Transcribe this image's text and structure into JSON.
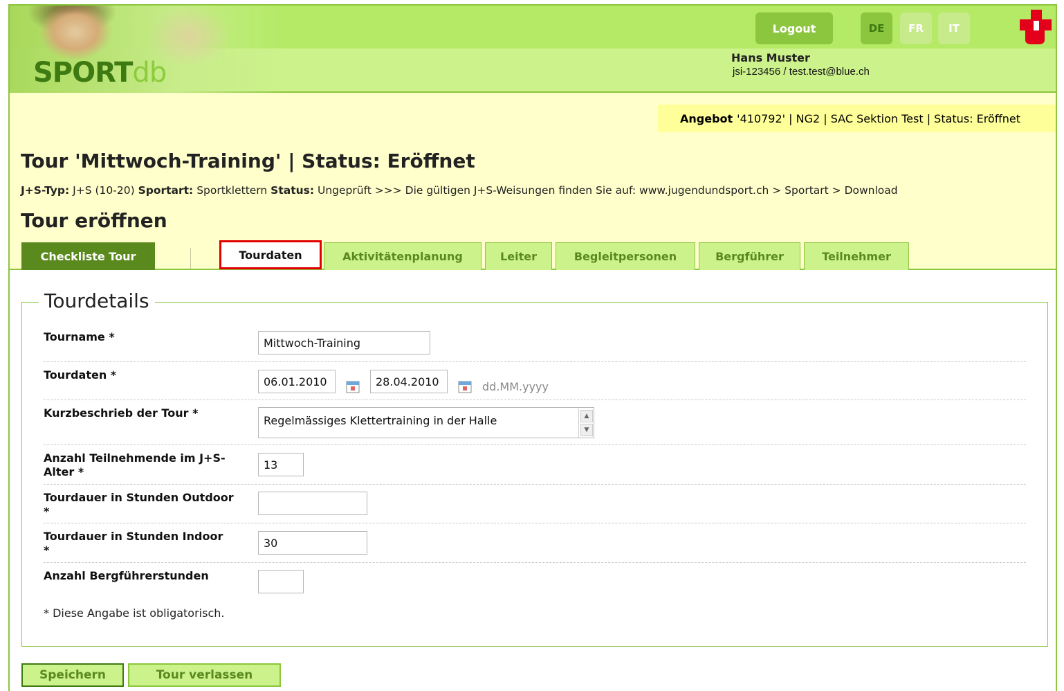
{
  "header": {
    "logo_sport": "SPORT",
    "logo_db": "db",
    "logout_label": "Logout",
    "languages": [
      "DE",
      "FR",
      "IT"
    ],
    "active_language": "DE",
    "user_name": "Hans Muster",
    "user_meta": "jsi-123456 / test.test@blue.ch"
  },
  "offer": {
    "label": "Angebot",
    "text": "'410792' | NG2 | SAC Sektion Test | Status: Eröffnet"
  },
  "tour": {
    "title": "Tour 'Mittwoch-Training' | Status: Eröffnet",
    "type_label": "J+S-Typ:",
    "type_value": "J+S (10-20)",
    "sport_label": "Sportart:",
    "sport_value": "Sportklettern",
    "status_label": "Status:",
    "status_value": "Ungeprüft >>> Die gültigen J+S-Weisungen finden Sie auf: www.jugendundsport.ch > Sportart > Download",
    "section_title": "Tour eröffnen"
  },
  "tabs": {
    "checklist": "Checkliste Tour",
    "items": [
      "Tourdaten",
      "Aktivitätenplanung",
      "Leiter",
      "Begleitpersonen",
      "Bergführer",
      "Teilnehmer"
    ],
    "selected": "Tourdaten"
  },
  "form": {
    "legend": "Tourdetails",
    "tourname_label": "Tourname *",
    "tourname_value": "Mittwoch-Training",
    "tourdaten_label": "Tourdaten *",
    "date_from": "06.01.2010",
    "date_to": "28.04.2010",
    "date_hint": "dd.MM.yyyy",
    "kurzbeschrieb_label": "Kurzbeschrieb der Tour *",
    "kurzbeschrieb_value": "Regelmässiges Klettertraining in der Halle",
    "anzahl_teilnehmende_label_1": "Anzahl Teilnehmende im J+S-",
    "anzahl_teilnehmende_label_2": "Alter *",
    "anzahl_teilnehmende_value": "13",
    "outdoor_label_1": "Tourdauer in Stunden Outdoor",
    "outdoor_label_2": "*",
    "outdoor_value": "",
    "indoor_label_1": "Tourdauer in Stunden Indoor",
    "indoor_label_2": "*",
    "indoor_value": "30",
    "bergfuehrer_label": "Anzahl Bergführerstunden",
    "bergfuehrer_value": "",
    "required_note": "* Diese Angabe ist obligatorisch."
  },
  "actions": {
    "save_label": "Speichern",
    "leave_label": "Tour verlassen"
  },
  "colors": {
    "brand_green": "#8cc63f",
    "dark_green": "#5a8a1e",
    "light_green": "#ccf28c",
    "highlight_red": "#e00000",
    "offer_yellow": "#ffff99"
  }
}
